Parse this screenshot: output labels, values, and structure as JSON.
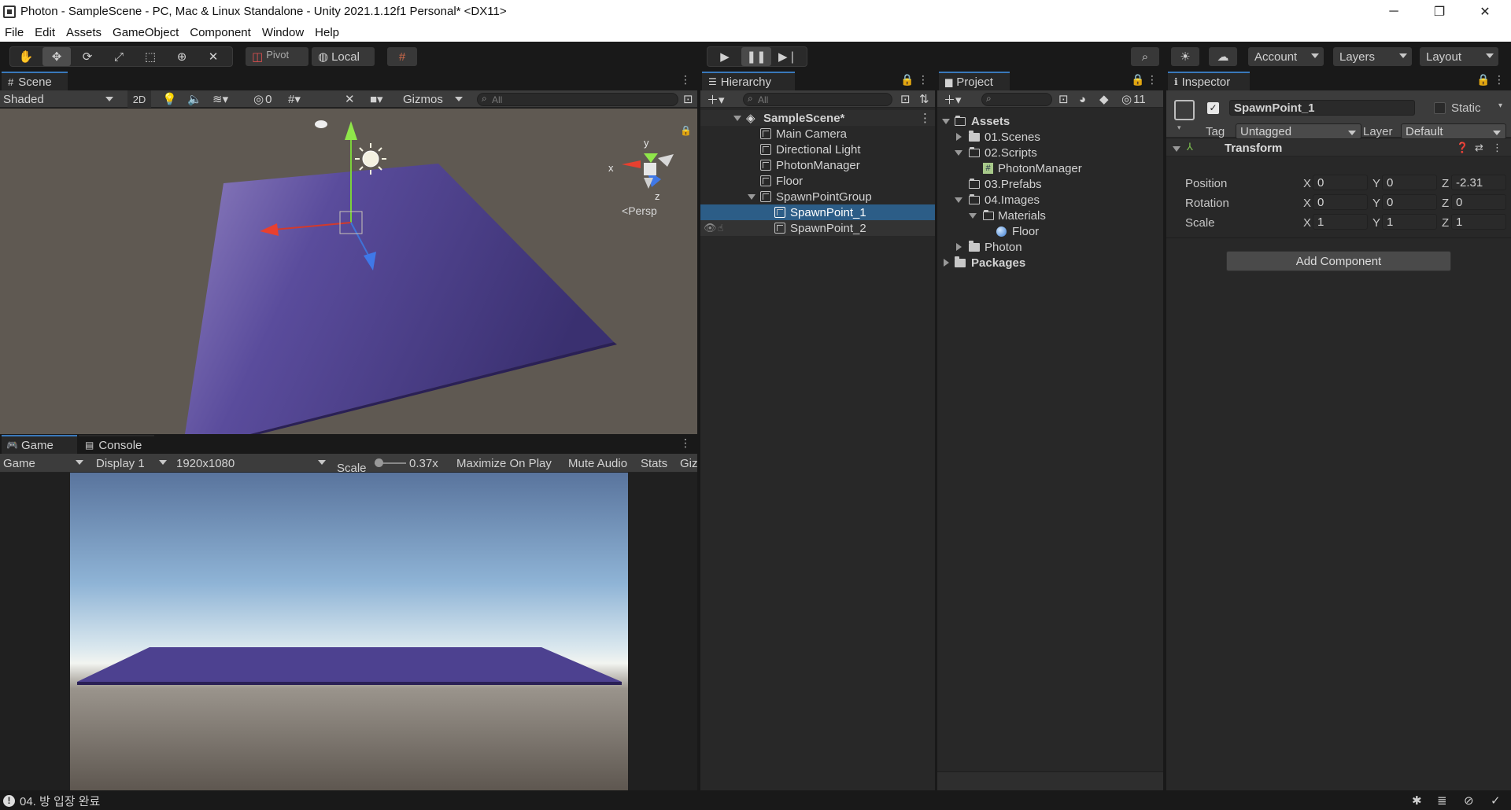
{
  "window": {
    "title": "Photon - SampleScene - PC, Mac & Linux Standalone - Unity 2021.1.12f1 Personal* <DX11>",
    "minimize": "─",
    "restore": "❐",
    "close": "✕"
  },
  "menu": [
    "File",
    "Edit",
    "Assets",
    "GameObject",
    "Component",
    "Window",
    "Help"
  ],
  "toolbar": {
    "pivot_label": "Pivot",
    "local_label": "Local",
    "account_label": "Account",
    "layers_label": "Layers",
    "layout_label": "Layout"
  },
  "scene": {
    "tab_label": "Scene",
    "shading_mode": "Shaded",
    "twod_label": "2D",
    "hidden_count": "0",
    "gizmos_label": "Gizmos",
    "search_placeholder": "All",
    "persp_label": "Persp",
    "axis_x": "x",
    "axis_y": "y",
    "axis_z": "z"
  },
  "game": {
    "tab_label": "Game",
    "console_tab_label": "Console",
    "view_mode": "Game",
    "display": "Display 1",
    "resolution": "1920x1080",
    "scale_label": "Scale",
    "scale_value": "0.37x",
    "maximize_label": "Maximize On Play",
    "mute_label": "Mute Audio",
    "stats_label": "Stats",
    "gizmos_label": "Giz"
  },
  "hierarchy": {
    "tab_label": "Hierarchy",
    "search_placeholder": "All",
    "scene_name": "SampleScene*",
    "items": [
      "Main Camera",
      "Directional Light",
      "PhotonManager",
      "Floor",
      "SpawnPointGroup"
    ],
    "children": [
      "SpawnPoint_1",
      "SpawnPoint_2"
    ]
  },
  "project": {
    "tab_label": "Project",
    "hidden_packages_count": "11",
    "assets_label": "Assets",
    "scenes_label": "01.Scenes",
    "scripts_label": "02.Scripts",
    "script_file": "PhotonManager",
    "prefabs_label": "03.Prefabs",
    "images_label": "04.Images",
    "materials_label": "Materials",
    "material_file": "Floor",
    "photon_label": "Photon",
    "packages_label": "Packages"
  },
  "inspector": {
    "tab_label": "Inspector",
    "object_name": "SpawnPoint_1",
    "static_label": "Static",
    "tag_label": "Tag",
    "tag_value": "Untagged",
    "layer_label": "Layer",
    "layer_value": "Default",
    "transform_label": "Transform",
    "position_label": "Position",
    "rotation_label": "Rotation",
    "scale_label": "Scale",
    "x": "X",
    "y": "Y",
    "z": "Z",
    "position": [
      "0",
      "0",
      "-2.31"
    ],
    "rotation": [
      "0",
      "0",
      "0"
    ],
    "scale": [
      "1",
      "1",
      "1"
    ],
    "add_component_label": "Add Component"
  },
  "status": {
    "message": "04. 방 입장 완료"
  },
  "colors": {
    "selection": "#2c5d87",
    "accent": "#3a79bb",
    "floor": "#4a3f8c"
  }
}
